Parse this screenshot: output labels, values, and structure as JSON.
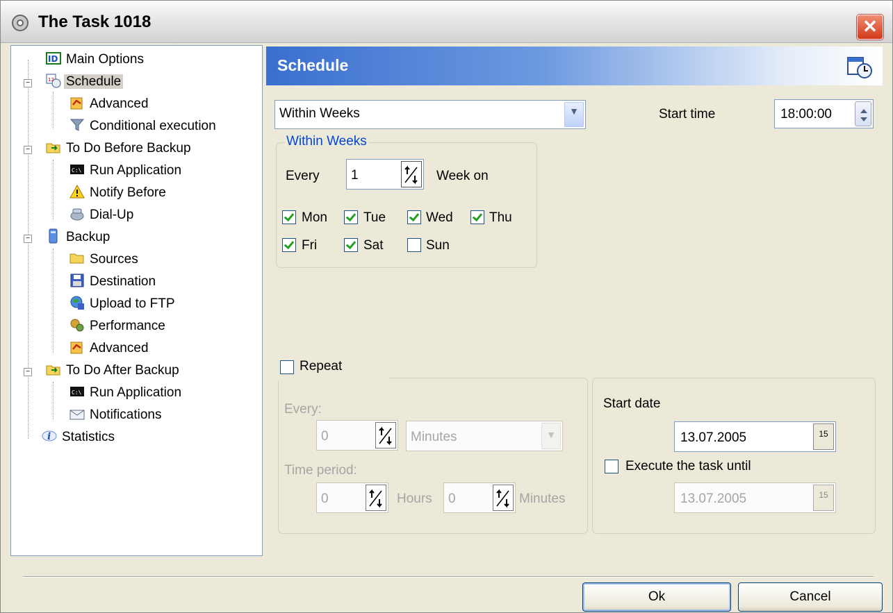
{
  "window": {
    "title": "The Task 1018",
    "close_label": "✕"
  },
  "tree": {
    "items": [
      {
        "label": "Main Options",
        "icon": "id-icon"
      },
      {
        "label": "Schedule",
        "icon": "calendar-clock-icon",
        "selected": true
      },
      {
        "label": "Advanced",
        "icon": "advanced-icon"
      },
      {
        "label": "Conditional execution",
        "icon": "filter-icon"
      },
      {
        "label": "To Do Before Backup",
        "icon": "folder-arrow-icon"
      },
      {
        "label": "Run Application",
        "icon": "console-icon"
      },
      {
        "label": "Notify Before",
        "icon": "warning-icon"
      },
      {
        "label": "Dial-Up",
        "icon": "dialup-icon"
      },
      {
        "label": "Backup",
        "icon": "computer-icon"
      },
      {
        "label": "Sources",
        "icon": "folder-icon"
      },
      {
        "label": "Destination",
        "icon": "floppy-icon"
      },
      {
        "label": "Upload to FTP",
        "icon": "globe-icon"
      },
      {
        "label": "Performance",
        "icon": "gears-icon"
      },
      {
        "label": "Advanced",
        "icon": "advanced-icon"
      },
      {
        "label": "To Do After Backup",
        "icon": "folder-arrow-icon"
      },
      {
        "label": "Run Application",
        "icon": "console-icon"
      },
      {
        "label": "Notifications",
        "icon": "envelope-icon"
      },
      {
        "label": "Statistics",
        "icon": "info-icon"
      }
    ]
  },
  "panel": {
    "title": "Schedule",
    "icon": "schedule-clock-icon"
  },
  "schedule": {
    "mode_value": "Within Weeks",
    "start_time_label": "Start time",
    "start_time_value": "18:00:00",
    "group_title": "Within Weeks",
    "every_label": "Every",
    "every_value": "1",
    "week_on_label": "Week on",
    "days": [
      {
        "label": "Mon",
        "checked": true
      },
      {
        "label": "Tue",
        "checked": true
      },
      {
        "label": "Wed",
        "checked": true
      },
      {
        "label": "Thu",
        "checked": true
      },
      {
        "label": "Fri",
        "checked": true
      },
      {
        "label": "Sat",
        "checked": true
      },
      {
        "label": "Sun",
        "checked": false
      }
    ]
  },
  "repeat": {
    "label": "Repeat",
    "checked": false,
    "every_label": "Every:",
    "every_value": "0",
    "unit_value": "Minutes",
    "period_label": "Time period:",
    "hours_value": "0",
    "hours_label": "Hours",
    "minutes_value": "0",
    "minutes_label": "Minutes"
  },
  "dates": {
    "start_date_label": "Start date",
    "start_date_value": "13.07.2005",
    "until_label": "Execute the task until",
    "until_checked": false,
    "until_value": "13.07.2005",
    "calendar_glyph": "15"
  },
  "buttons": {
    "ok": "Ok",
    "cancel": "Cancel"
  },
  "colors": {
    "header_start": "#3a6fcf",
    "group_title": "#0046d5",
    "check": "#21a121"
  }
}
